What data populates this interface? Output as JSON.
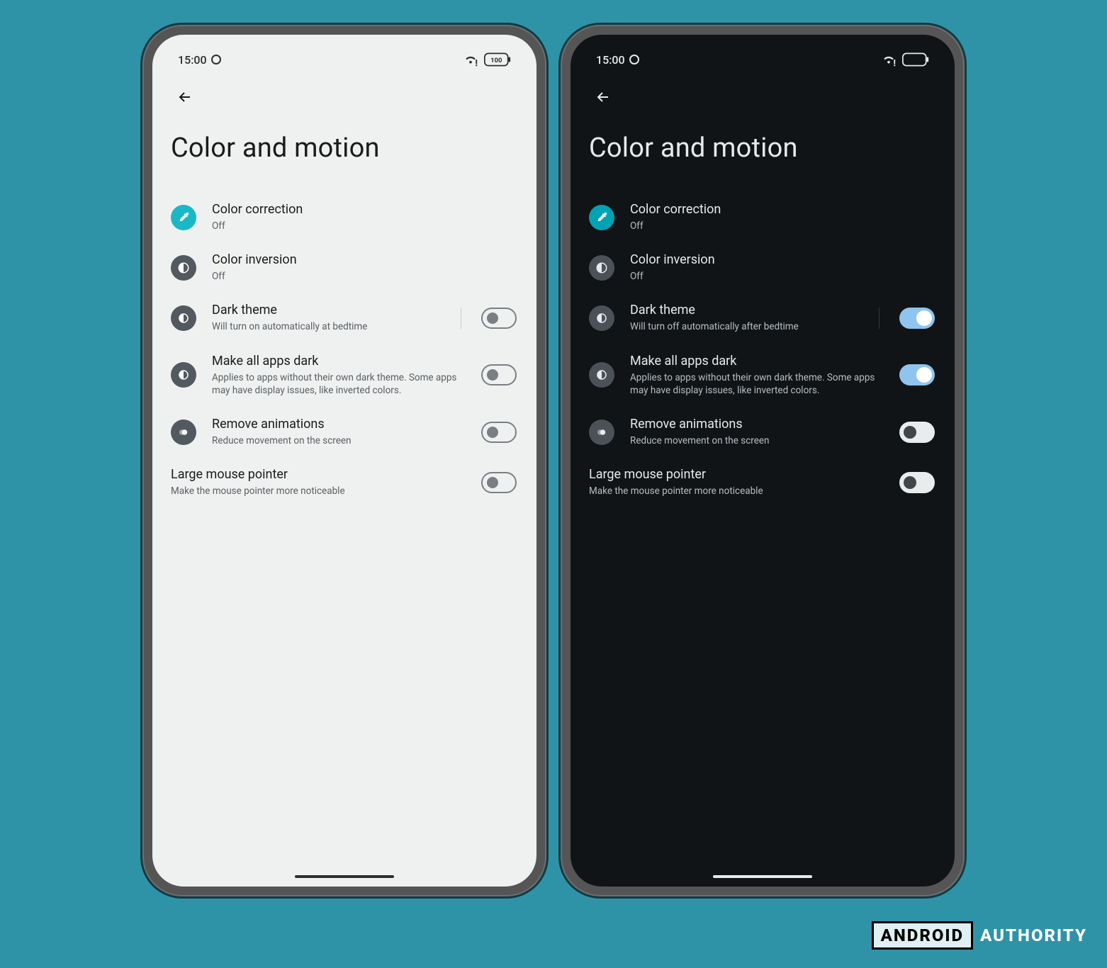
{
  "watermark": {
    "boxed": "ANDROID",
    "plain": "AUTHORITY"
  },
  "phones": [
    {
      "theme": "light",
      "status": {
        "time": "15:00",
        "battery_label": "100"
      },
      "page_title": "Color and motion",
      "rows": {
        "color_correction": {
          "label": "Color correction",
          "sub": "Off"
        },
        "color_inversion": {
          "label": "Color inversion",
          "sub": "Off"
        },
        "dark_theme": {
          "label": "Dark theme",
          "sub": "Will turn on automatically at bedtime",
          "on": false
        },
        "make_all_apps_dark": {
          "label": "Make all apps dark",
          "sub": "Applies to apps without their own dark theme. Some apps may have display issues, like inverted colors.",
          "on": false
        },
        "remove_animations": {
          "label": "Remove animations",
          "sub": "Reduce movement on the screen",
          "on": false
        },
        "large_mouse_pointer": {
          "label": "Large mouse pointer",
          "sub": "Make the mouse pointer more noticeable",
          "on": false
        }
      }
    },
    {
      "theme": "dark",
      "status": {
        "time": "15:00",
        "battery_label": ""
      },
      "page_title": "Color and motion",
      "rows": {
        "color_correction": {
          "label": "Color correction",
          "sub": "Off"
        },
        "color_inversion": {
          "label": "Color inversion",
          "sub": "Off"
        },
        "dark_theme": {
          "label": "Dark theme",
          "sub": "Will turn off automatically after bedtime",
          "on": true
        },
        "make_all_apps_dark": {
          "label": "Make all apps dark",
          "sub": "Applies to apps without their own dark theme. Some apps may have display issues, like inverted colors.",
          "on": true
        },
        "remove_animations": {
          "label": "Remove animations",
          "sub": "Reduce movement on the screen",
          "on": false
        },
        "large_mouse_pointer": {
          "label": "Large mouse pointer",
          "sub": "Make the mouse pointer more noticeable",
          "on": false
        }
      }
    }
  ]
}
